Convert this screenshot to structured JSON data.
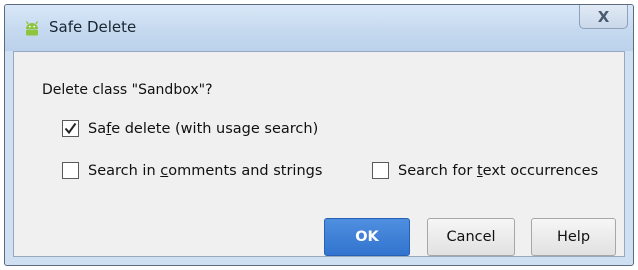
{
  "dialog": {
    "title": "Safe Delete",
    "close_glyph": "X",
    "question": "Delete class \"Sandbox\"?",
    "options": {
      "safe_delete": {
        "label_before": "Sa",
        "label_mnemonic": "f",
        "label_after": "e delete (with usage search)",
        "checked": true
      },
      "search_comments": {
        "label_before": "Search in ",
        "label_mnemonic": "c",
        "label_after": "omments and strings",
        "checked": false
      },
      "search_text": {
        "label_before": "Search for ",
        "label_mnemonic": "t",
        "label_after": "ext occurrences",
        "checked": false
      }
    },
    "buttons": {
      "ok": "OK",
      "cancel": "Cancel",
      "help": "Help"
    }
  },
  "icons": {
    "app": "android-robot-icon",
    "close": "close-icon",
    "check": "checkmark-icon"
  },
  "colors": {
    "accent": "#3274cf",
    "titlebar": "#c5d9ef",
    "android_green": "#8fc43f"
  }
}
